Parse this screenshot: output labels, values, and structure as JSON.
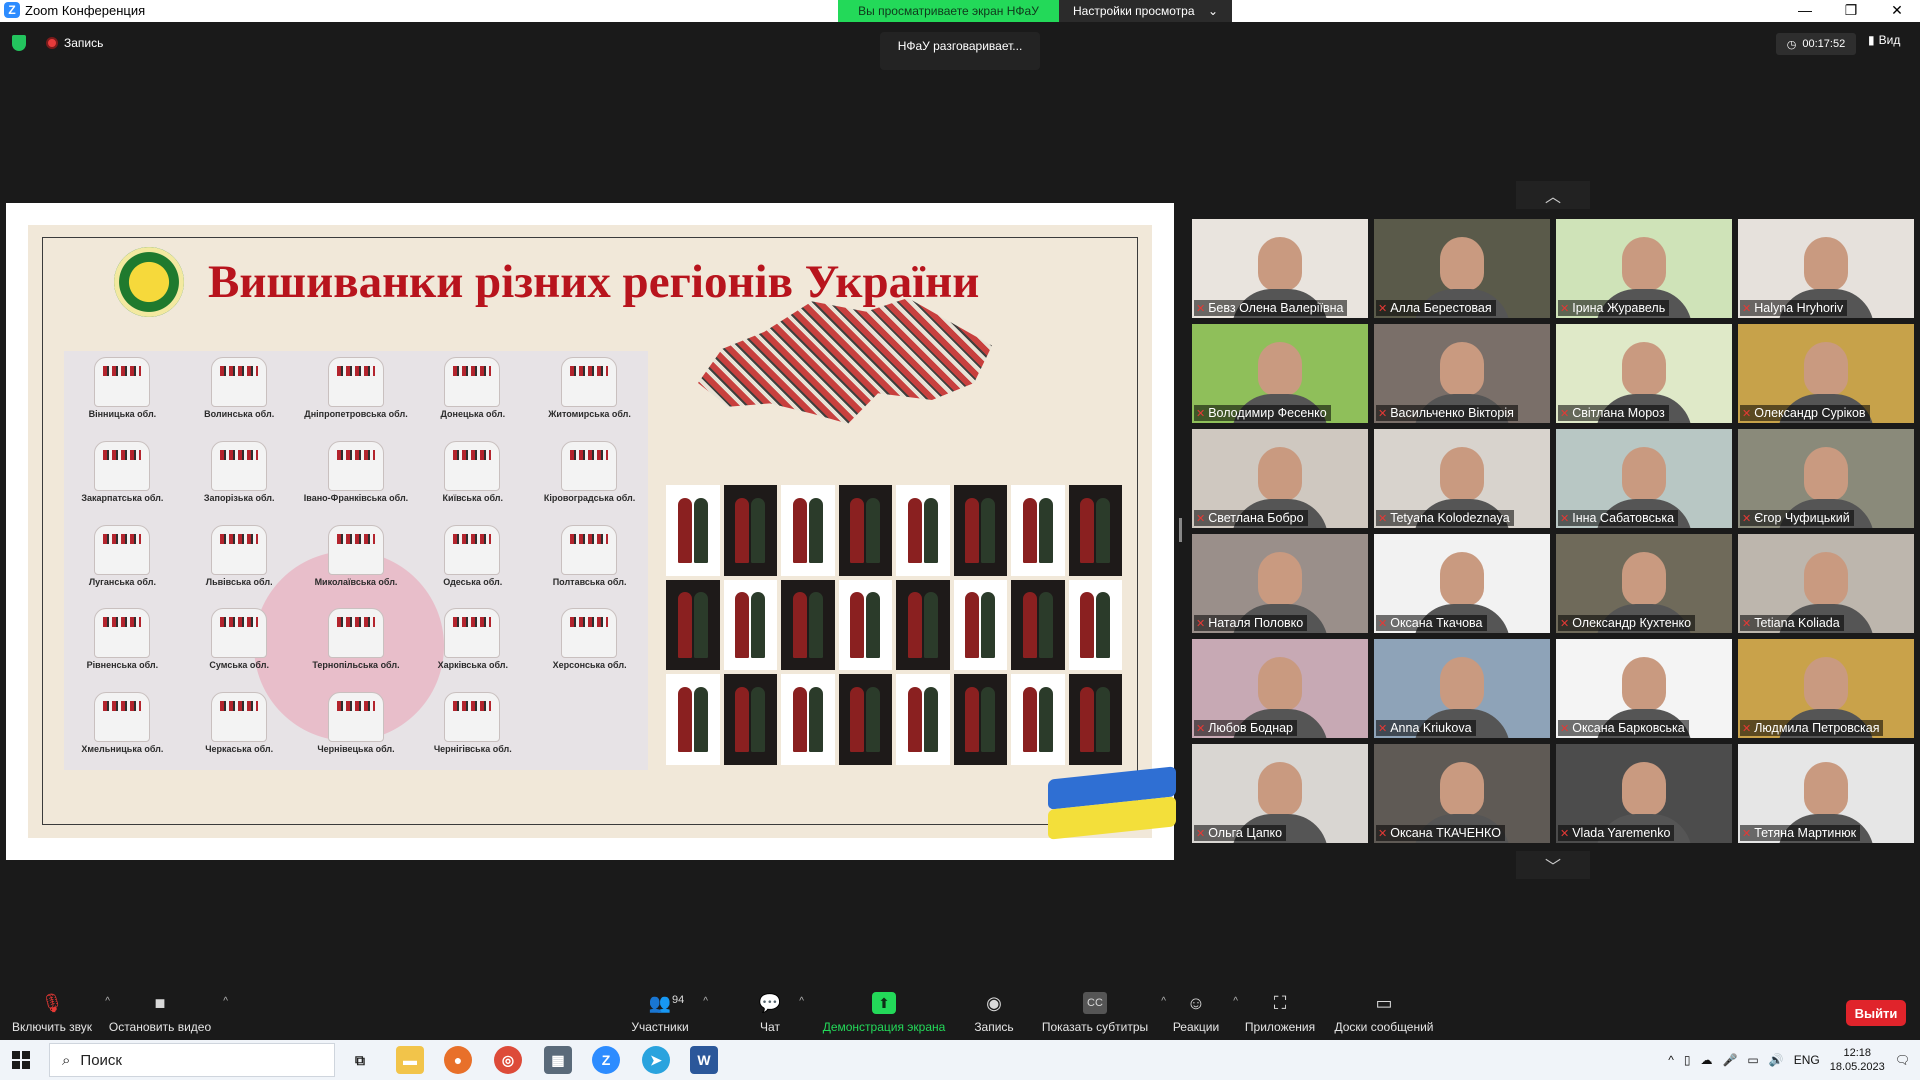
{
  "window": {
    "title": "Zoom Конференция"
  },
  "share_banner": {
    "viewing": "Вы просматриваете экран НФаУ",
    "view_settings": "Настройки просмотра"
  },
  "topbar": {
    "recording": "Запись",
    "speaking": "НФаУ разговаривает...",
    "timer": "00:17:52",
    "view": "Вид"
  },
  "slide": {
    "title": "Вишиванки різних регіонів України",
    "regions": [
      "Вінницька обл.",
      "Волинська обл.",
      "Дніпропетровська обл.",
      "Донецька обл.",
      "Житомирська обл.",
      "Закарпатська обл.",
      "Запорізька обл.",
      "Івано-Франківська обл.",
      "Київська обл.",
      "Кіровоградська обл.",
      "Луганська обл.",
      "Львівська обл.",
      "Миколаївська обл.",
      "Одеська обл.",
      "Полтавська обл.",
      "Рівненська обл.",
      "Сумська обл.",
      "Тернопільська обл.",
      "Харківська обл.",
      "Херсонська обл.",
      "Хмельницька обл.",
      "Черкаська обл.",
      "Чернівецька обл.",
      "Чернігівська обл.",
      ""
    ]
  },
  "participants": [
    {
      "name": "Бевз Олена Валеріївна",
      "bg": "#e9e4de"
    },
    {
      "name": "Алла Берестовая",
      "bg": "#5a5a4a"
    },
    {
      "name": "Ірина Журавель",
      "bg": "#cfe3b8"
    },
    {
      "name": "Halyna Hryhoriv",
      "bg": "#e6e1dc"
    },
    {
      "name": "Володимир Фесенко",
      "bg": "#8fbf5a"
    },
    {
      "name": "Васильченко Вікторія",
      "bg": "#7a6f69"
    },
    {
      "name": "Світлана Мороз",
      "bg": "#dfe9c8"
    },
    {
      "name": "Олександр Суріков",
      "bg": "#c7a24a"
    },
    {
      "name": "Светлана Бобро",
      "bg": "#cfc8c0"
    },
    {
      "name": "Tetyana Kolodeznaya",
      "bg": "#d8d3cd"
    },
    {
      "name": "Інна Сабатовська",
      "bg": "#b8c7c4"
    },
    {
      "name": "Єгор Чуфицький",
      "bg": "#8a8a7a"
    },
    {
      "name": "Наталя Половко",
      "bg": "#9a8f8a"
    },
    {
      "name": "Оксана Ткачова",
      "bg": "#f2f2f2"
    },
    {
      "name": "Олександр Кухтенко",
      "bg": "#6f6a5a"
    },
    {
      "name": "Tetiana Koliada",
      "bg": "#bdb6ad"
    },
    {
      "name": "Любов Боднар",
      "bg": "#c7a9b4"
    },
    {
      "name": "Anna Kriukova",
      "bg": "#8ea3b8"
    },
    {
      "name": "Оксана Барковська",
      "bg": "#f4f4f4"
    },
    {
      "name": "Людмила Петровская",
      "bg": "#c9a24a"
    },
    {
      "name": "Ольга Цапко",
      "bg": "#d9d6d2"
    },
    {
      "name": "Оксана ТКАЧЕНКО",
      "bg": "#5f5a55"
    },
    {
      "name": "Vlada Yaremenko",
      "bg": "#4c4c4c"
    },
    {
      "name": "Тетяна Мартинюк",
      "bg": "#e6e6e6"
    }
  ],
  "toolbar": {
    "mute": "Включить звук",
    "video": "Остановить видео",
    "participants": "Участники",
    "participants_count": "94",
    "chat": "Чат",
    "share": "Демонстрация экрана",
    "record": "Запись",
    "captions": "Показать субтитры",
    "reactions": "Реакции",
    "apps": "Приложения",
    "whiteboards": "Доски сообщений",
    "leave": "Выйти"
  },
  "taskbar": {
    "search": "Поиск",
    "lang": "ENG",
    "time": "12:18",
    "date": "18.05.2023"
  },
  "icons": [
    "shield-icon",
    "record-dot-icon",
    "clock-icon",
    "view-icon",
    "mic-muted-icon",
    "camera-icon",
    "participants-icon",
    "chat-icon",
    "share-arrow-icon",
    "record-icon",
    "cc-icon",
    "reactions-icon",
    "apps-icon",
    "whiteboard-icon",
    "windows-icon",
    "search-icon"
  ],
  "colors": {
    "accent": "#23d959",
    "leave": "#e0242b",
    "slide_title": "#b8141d",
    "muted_mic": "#e53935"
  }
}
